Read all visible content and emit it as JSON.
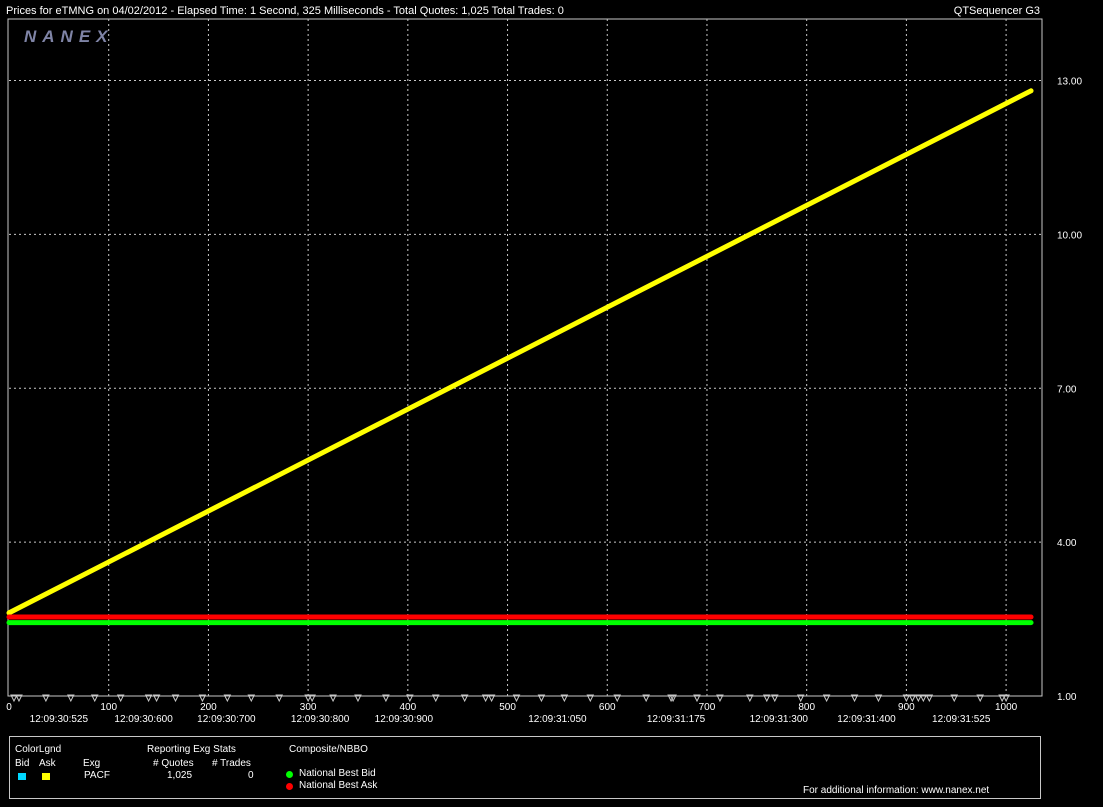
{
  "header": {
    "title": "Prices for  eTMNG  on  04/02/2012  -  Elapsed Time: 1 Second, 325 Milliseconds  -  Total Quotes: 1,025  Total Trades: 0",
    "app": "QTSequencer G3",
    "logo": "NANEX"
  },
  "chart_data": {
    "type": "line",
    "x_ticks": [
      "0",
      "100",
      "200",
      "300",
      "400",
      "500",
      "600",
      "700",
      "800",
      "900",
      "1000"
    ],
    "time_ticks": [
      {
        "x": 50,
        "label": "12:09:30:525"
      },
      {
        "x": 135,
        "label": "12:09:30:600"
      },
      {
        "x": 218,
        "label": "12:09:30:700"
      },
      {
        "x": 312,
        "label": "12:09:30:800"
      },
      {
        "x": 396,
        "label": "12:09:30:900"
      },
      {
        "x": 550,
        "label": "12:09:31:050"
      },
      {
        "x": 669,
        "label": "12:09:31:175"
      },
      {
        "x": 772,
        "label": "12:09:31:300"
      },
      {
        "x": 860,
        "label": "12:09:31:400"
      },
      {
        "x": 955,
        "label": "12:09:31:525"
      }
    ],
    "y_ticks": [
      "1.00",
      "4.00",
      "7.00",
      "10.00",
      "13.00"
    ],
    "xlim": [
      0,
      1035
    ],
    "ylim": [
      1,
      14.2
    ],
    "grid": true,
    "series": [
      {
        "name": "Ask",
        "color": "#ffff00",
        "x": [
          0,
          1025
        ],
        "y": [
          2.62,
          12.8
        ]
      },
      {
        "name": "National Best Ask",
        "color": "#ff0000",
        "x": [
          0,
          1025
        ],
        "y": [
          2.54,
          2.54
        ]
      },
      {
        "name": "National Best Bid",
        "color": "#00ff00",
        "x": [
          0,
          1025
        ],
        "y": [
          2.43,
          2.43
        ]
      }
    ],
    "quote_marks_x": [
      5,
      10,
      37,
      62,
      86,
      112,
      140,
      148,
      167,
      194,
      219,
      243,
      271,
      300,
      304,
      325,
      350,
      378,
      402,
      428,
      457,
      478,
      484,
      509,
      534,
      557,
      583,
      610,
      639,
      664,
      666,
      690,
      713,
      743,
      760,
      768,
      794,
      820,
      848,
      872,
      900,
      906,
      912,
      917,
      923,
      948,
      974,
      996,
      1000
    ]
  },
  "legend": {
    "colorlgnd": "ColorLgnd",
    "bid": "Bid",
    "ask": "Ask",
    "exg": "Exg",
    "reporting": "Reporting Exg Stats",
    "quotes_hdr": "# Quotes",
    "trades_hdr": "# Trades",
    "exchange": "PACF",
    "quotes": "1,025",
    "trades": "0",
    "composite": "Composite/NBBO",
    "nbb": "National Best Bid",
    "nba": "National Best Ask",
    "info": "For additional information: www.nanex.net",
    "bid_color": "#00d8ff",
    "ask_color": "#ffff00",
    "nbb_color": "#00ff00",
    "nba_color": "#ff0000"
  }
}
